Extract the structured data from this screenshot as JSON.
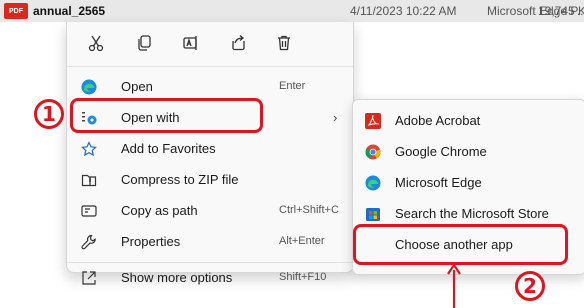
{
  "file_row": {
    "icon_label": "PDF",
    "name": "annual_2565",
    "date": "4/11/2023 10:22 AM",
    "type": "Microsoft Edge P...",
    "size": "19,745 KI"
  },
  "quick_actions": [
    "cut-icon",
    "copy-icon",
    "rename-icon",
    "share-icon",
    "delete-icon"
  ],
  "menu": {
    "open": {
      "label": "Open",
      "shortcut": "Enter"
    },
    "open_with": {
      "label": "Open with",
      "arrow": "›"
    },
    "add_favorites": {
      "label": "Add to Favorites"
    },
    "compress": {
      "label": "Compress to ZIP file"
    },
    "copy_path": {
      "label": "Copy as path",
      "shortcut": "Ctrl+Shift+C"
    },
    "properties": {
      "label": "Properties",
      "shortcut": "Alt+Enter"
    },
    "show_more": {
      "label": "Show more options",
      "shortcut": "Shift+F10"
    }
  },
  "submenu": {
    "acrobat": {
      "label": "Adobe Acrobat"
    },
    "chrome": {
      "label": "Google Chrome"
    },
    "edge": {
      "label": "Microsoft Edge"
    },
    "store": {
      "label": "Search the Microsoft Store"
    },
    "choose": {
      "label": "Choose another app"
    }
  },
  "annotations": {
    "step1": "1",
    "step2": "2",
    "color": "#e0141e"
  }
}
